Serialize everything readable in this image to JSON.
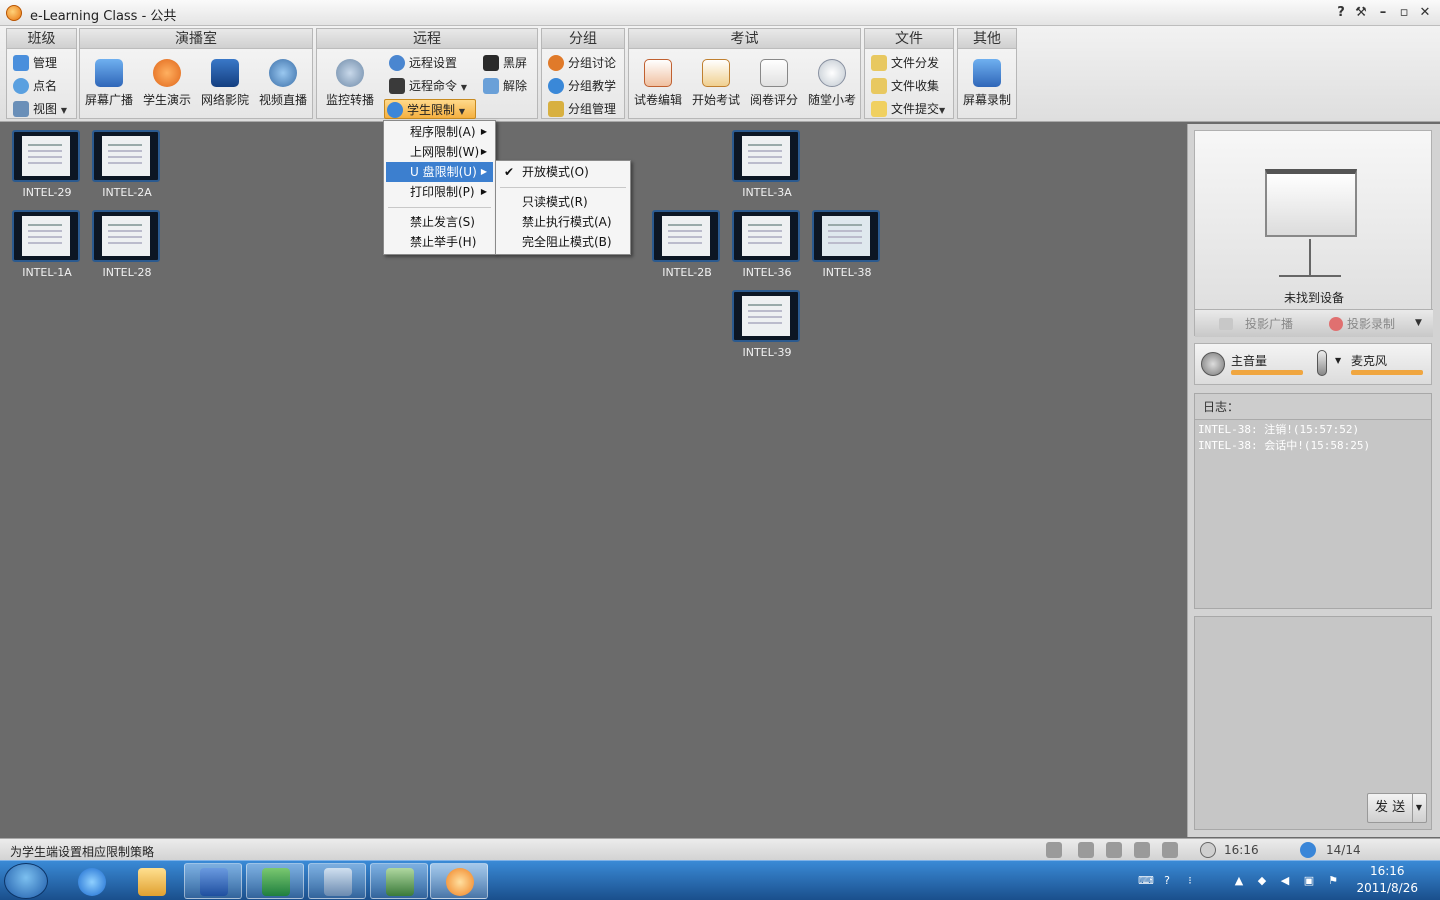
{
  "window": {
    "title": "e-Learning Class - 公共",
    "controls": [
      "?",
      "⚒",
      "–",
      "▫",
      "✕"
    ]
  },
  "toolbar": {
    "groups": [
      {
        "name": "班级"
      },
      {
        "name": "演播室"
      },
      {
        "name": "远程"
      },
      {
        "name": "分组"
      },
      {
        "name": "考试"
      },
      {
        "name": "文件"
      },
      {
        "name": "其他"
      }
    ],
    "class": {
      "manage": "管理",
      "rollcall": "点名",
      "view": "视图"
    },
    "studio": {
      "screen_broadcast": "屏幕广播",
      "student_demo": "学生演示",
      "network_cinema": "网络影院",
      "video_live": "视频直播"
    },
    "remote": {
      "monitor_relay": "监控转播",
      "remote_settings": "远程设置",
      "remote_command": "远程命令",
      "student_limit": "学生限制",
      "black_screen": "黑屏",
      "release": "解除"
    },
    "grouping": {
      "group_discussion": "分组讨论",
      "group_teaching": "分组教学",
      "group_manage": "分组管理"
    },
    "exam": {
      "paper_edit": "试卷编辑",
      "start_exam": "开始考试",
      "grade_paper": "阅卷评分",
      "quiz": "随堂小考"
    },
    "file": {
      "distribute": "文件分发",
      "collect": "文件收集",
      "submit": "文件提交"
    },
    "other": {
      "screen_record": "屏幕录制"
    }
  },
  "menu_student_limit": {
    "items": [
      "程序限制(A)",
      "上网限制(W)",
      "U 盘限制(U)",
      "打印限制(P)",
      "禁止发言(S)",
      "禁止举手(H)"
    ]
  },
  "menu_usb_limit": {
    "items": [
      "开放模式(O)",
      "只读模式(R)",
      "禁止执行模式(A)",
      "完全阻止模式(B)"
    ],
    "checked": "开放模式(O)"
  },
  "computers": [
    "INTEL-29",
    "INTEL-2A",
    "INTEL-1A",
    "INTEL-28",
    "INTEL-3A",
    "INTEL-2B",
    "INTEL-36",
    "INTEL-38",
    "INTEL-39"
  ],
  "sidebar": {
    "device_status": "未找到设备",
    "projection_broadcast": "投影广播",
    "projection_record": "投影录制",
    "master_volume": "主音量",
    "microphone": "麦克风",
    "log_title": "日志：",
    "log_lines": [
      "INTEL-38: 注销!(15:57:52)",
      "INTEL-38: 会话中!(15:58:25)"
    ],
    "send": "发 送"
  },
  "statusbar": {
    "text": "为学生端设置相应限制策略",
    "time": "16:16",
    "online_count": "14/14"
  },
  "taskbar": {
    "clock_time": "16:16",
    "clock_date": "2011/8/26"
  },
  "colors": {
    "accent": "#3c7fcf",
    "highlight": "#f5b041",
    "workspace_bg": "#6b6b6b"
  }
}
